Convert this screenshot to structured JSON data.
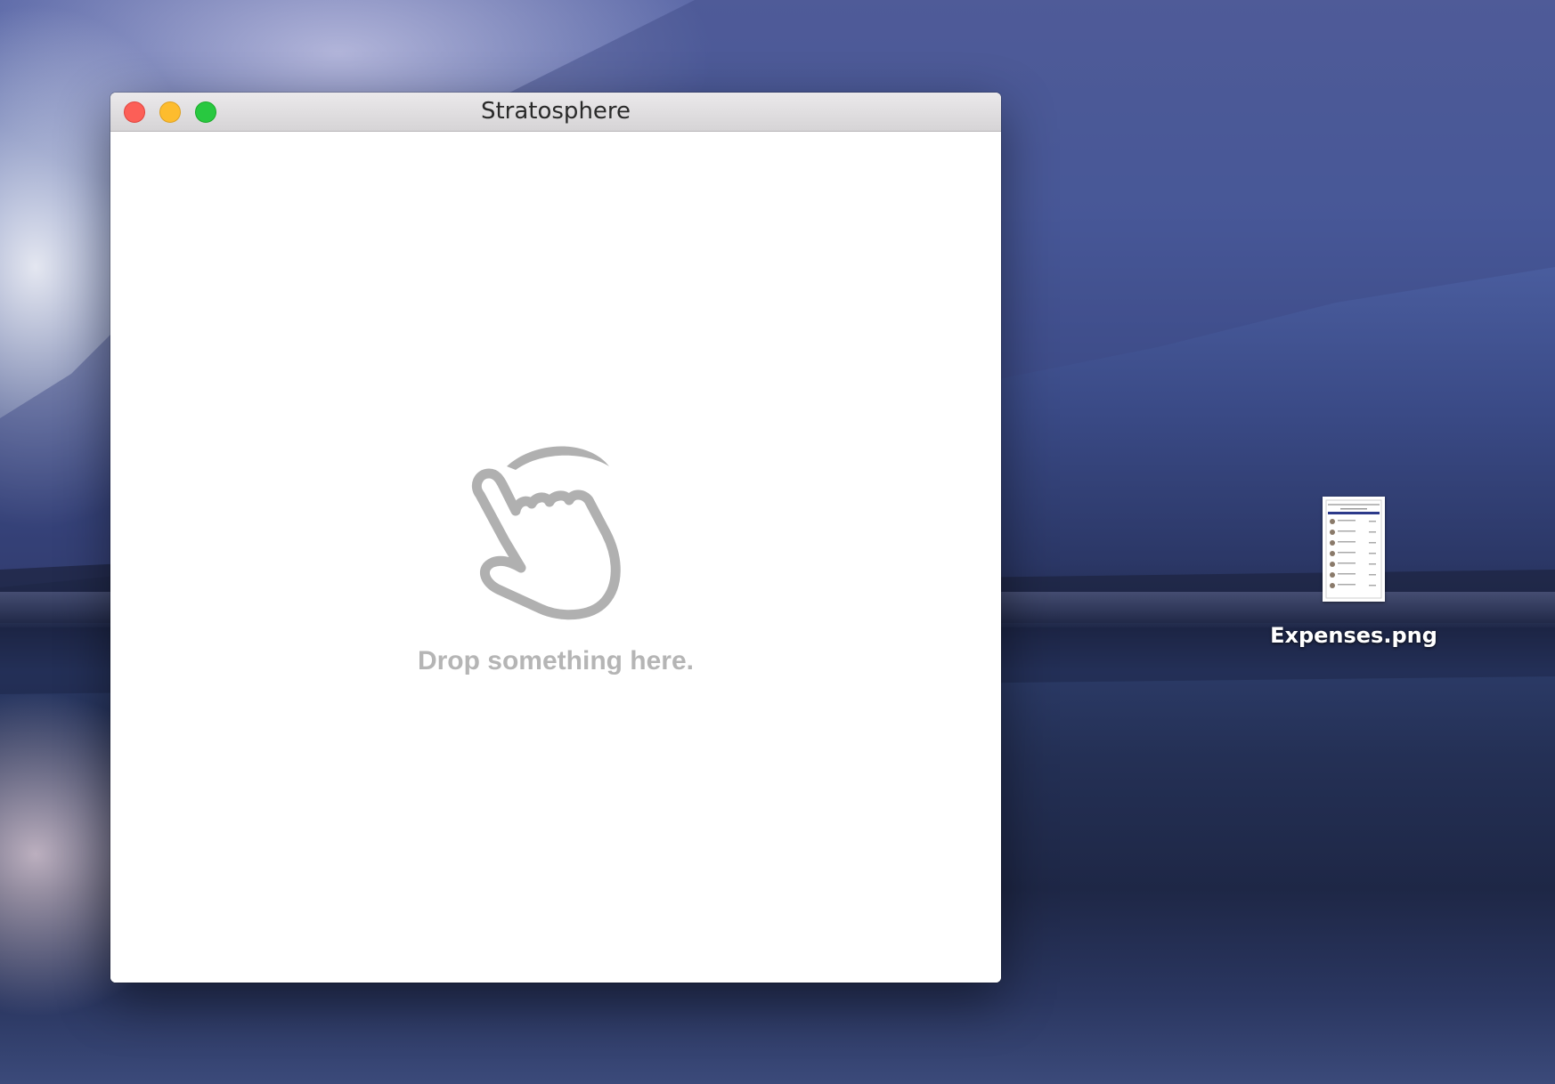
{
  "window": {
    "title": "Stratosphere",
    "controls": {
      "close": "close-button",
      "minimize": "minimize-button",
      "zoom": "zoom-button"
    }
  },
  "drop_zone": {
    "icon": "hand-pointer-icon",
    "message": "Drop something here."
  },
  "desktop": {
    "file": {
      "name": "Expenses.png",
      "icon": "image-file-thumbnail"
    }
  },
  "colors": {
    "close": "#fc5f57",
    "minimize": "#fdbc2e",
    "zoom": "#28c840",
    "drop_text": "#b5b5b5",
    "icon_stroke": "#b0b0b0"
  }
}
